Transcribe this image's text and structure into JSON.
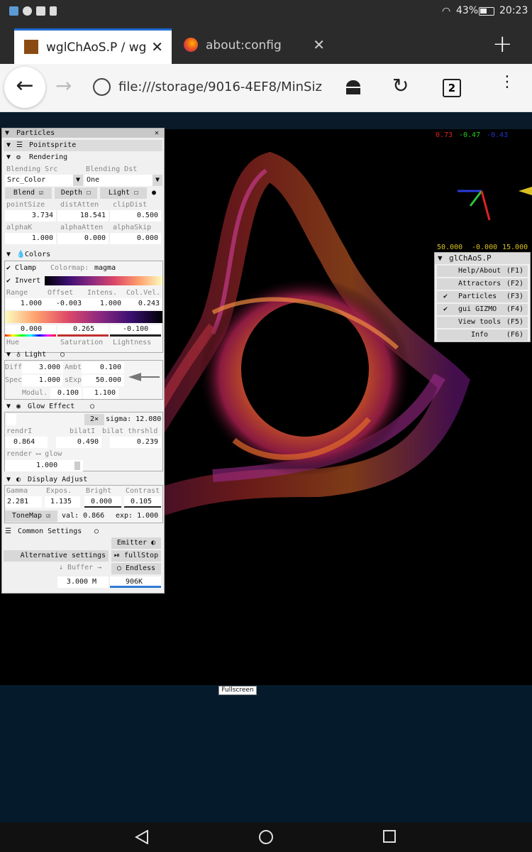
{
  "status_bar": {
    "battery": "43%",
    "time": "20:23"
  },
  "tabs": [
    {
      "title": "wglChAoS.P / wg",
      "active": true
    },
    {
      "title": "about:config",
      "active": false
    }
  ],
  "toolbar": {
    "url": "file:///storage/9016-4EF8/MinSiz",
    "tab_count": "2"
  },
  "overlay": {
    "axes_values": [
      "0.73",
      "-0.47",
      "-0.43"
    ],
    "pos_values": [
      "50.000",
      "-0.000",
      "15.000"
    ]
  },
  "fullscreen_label": "Fullscreen",
  "particles_panel": {
    "title": "Particles",
    "pointsprite": "Pointsprite",
    "rendering": "Rendering",
    "blending_src_label": "Blending Src",
    "blending_dst_label": "Blending Dst",
    "blending_src": "Src_Color",
    "blending_dst": "One",
    "blend": "Blend",
    "depth": "Depth",
    "light": "Light",
    "pointsize_label": "pointSize",
    "distatten_label": "distAtten",
    "clipdist_label": "clipDist",
    "pointsize": "3.734",
    "distatten": "18.541",
    "clipdist": "0.500",
    "alphak_label": "alphaK",
    "alphaatten_label": "alphaAtten",
    "alphaskip_label": "alphaSkip",
    "alphak": "1.000",
    "alphaatten": "0.000",
    "alphaskip": "0.000",
    "colors": "Colors",
    "clamp": "Clamp",
    "colormap_label": "Colormap:",
    "colormap": "magma",
    "invert": "Invert",
    "range_label": "Range",
    "offset_label": "Offset",
    "intens_label": "Intens.",
    "colvel_label": "Col.Vel.",
    "range": "1.000",
    "offset": "-0.003",
    "intens": "1.000",
    "colvel": "0.243",
    "hue_val": "0.000",
    "sat_val": "0.265",
    "light_val": "-0.100",
    "hue_label": "Hue",
    "sat_label": "Saturation",
    "lightness_label": "Lightness",
    "light_section": "Light",
    "diff_label": "Diff",
    "diff": "3.000",
    "ambt_label": "Ambt",
    "ambt": "0.100",
    "spec_label": "Spec",
    "spec": "1.000",
    "sexp_label": "sExp",
    "sexp": "50.000",
    "modul_label": "Modul.",
    "modul1": "0.100",
    "modul2": "1.100",
    "glow_section": "Glow Effect",
    "glow_2x": "2×",
    "sigma": "sigma: 12.080",
    "rendri_label": "rendrI",
    "bilati_label": "bilatI",
    "bilat_thr_label": "bilat thrshld",
    "rendri": "0.864",
    "bilati": "0.490",
    "bilat_thr": "0.239",
    "render_glow_label": "render ⟷ glow",
    "render_glow": "1.000",
    "display_section": "Display Adjust",
    "gamma_label": "Gamma",
    "expos_label": "Expos.",
    "bright_label": "Bright",
    "contrast_label": "Contrast",
    "gamma": "2.281",
    "expos": "1.135",
    "bright": "0.000",
    "contrast": "0.105",
    "tonemap": "ToneMap",
    "val": "val: 0.866",
    "exp": "exp: 1.000",
    "common_section": "Common Settings",
    "emitter": "Emitter",
    "alt_settings": "Alternative settings",
    "fullstop": "fullStop",
    "buffer": "Buffer",
    "endless": "Endless",
    "buffer_size": "3.000 M",
    "count": "906K"
  },
  "main_menu": {
    "title": "glChAoS.P",
    "items": [
      {
        "label": "Help/About",
        "key": "(F1)",
        "checked": false
      },
      {
        "label": "Attractors",
        "key": "(F2)",
        "checked": false
      },
      {
        "label": "Particles",
        "key": "(F3)",
        "checked": true
      },
      {
        "label": "gui GIZMO",
        "key": "(F4)",
        "checked": true
      },
      {
        "label": "View tools",
        "key": "(F5)",
        "checked": false
      },
      {
        "label": "Info",
        "key": "(F6)",
        "checked": false
      }
    ]
  },
  "colors": {
    "accent": "#1e6ad1",
    "bg_dark": "#051b2c"
  }
}
